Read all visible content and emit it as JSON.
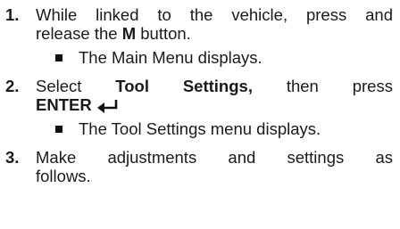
{
  "steps": [
    {
      "number": "1.",
      "line1": "While linked to the vehicle, press and",
      "line2_pre": "release the ",
      "line2_bold": "M",
      "line2_post": " button.",
      "result": "The Main Menu displays."
    },
    {
      "number": "2.",
      "word_select": "Select",
      "bold_tool": "Tool",
      "bold_settings": "Settings,",
      "word_then": "then",
      "word_press": "press",
      "bold_enter": "ENTER",
      "enter_icon": "enter-return-arrow",
      "result": "The Tool Settings menu displays."
    },
    {
      "number": "3.",
      "w_make": "Make",
      "w_adjustments": "adjustments",
      "w_and": "and",
      "w_settings": "settings",
      "w_as": "as",
      "line2": "follows."
    }
  ]
}
